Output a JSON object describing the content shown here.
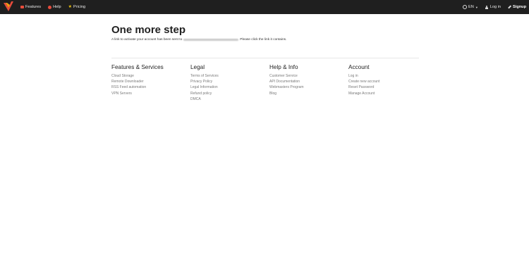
{
  "navbar": {
    "left_items": [
      {
        "label": "Features",
        "icon": "features-icon"
      },
      {
        "label": "Help",
        "icon": "help-icon"
      },
      {
        "label": "Pricing",
        "icon": "star-icon"
      }
    ],
    "language": "EN",
    "login_label": "Log in",
    "signup_label": "Signup"
  },
  "main": {
    "title": "One more step",
    "message_prefix": "A link to activate your account has been sent to",
    "message_suffix": "Please click the link it contains."
  },
  "footer": {
    "columns": [
      {
        "heading": "Features & Services",
        "links": [
          "Cloud Storage",
          "Remote Downloader",
          "RSS Feed automation",
          "VPN Servers"
        ]
      },
      {
        "heading": "Legal",
        "links": [
          "Terms of Services",
          "Privacy Policy",
          "Legal Information",
          "Refund policy",
          "DMCA"
        ]
      },
      {
        "heading": "Help & Info",
        "links": [
          "Customer Service",
          "API Documentation",
          "Webmasters Program",
          "Blog"
        ]
      },
      {
        "heading": "Account",
        "links": [
          "Log in",
          "Create new account",
          "Reset Password",
          "Manage Account"
        ]
      }
    ]
  },
  "colors": {
    "navbar_bg": "#1f1f1f",
    "accent_red": "#e74c3c",
    "star_yellow": "#f1c40f"
  }
}
